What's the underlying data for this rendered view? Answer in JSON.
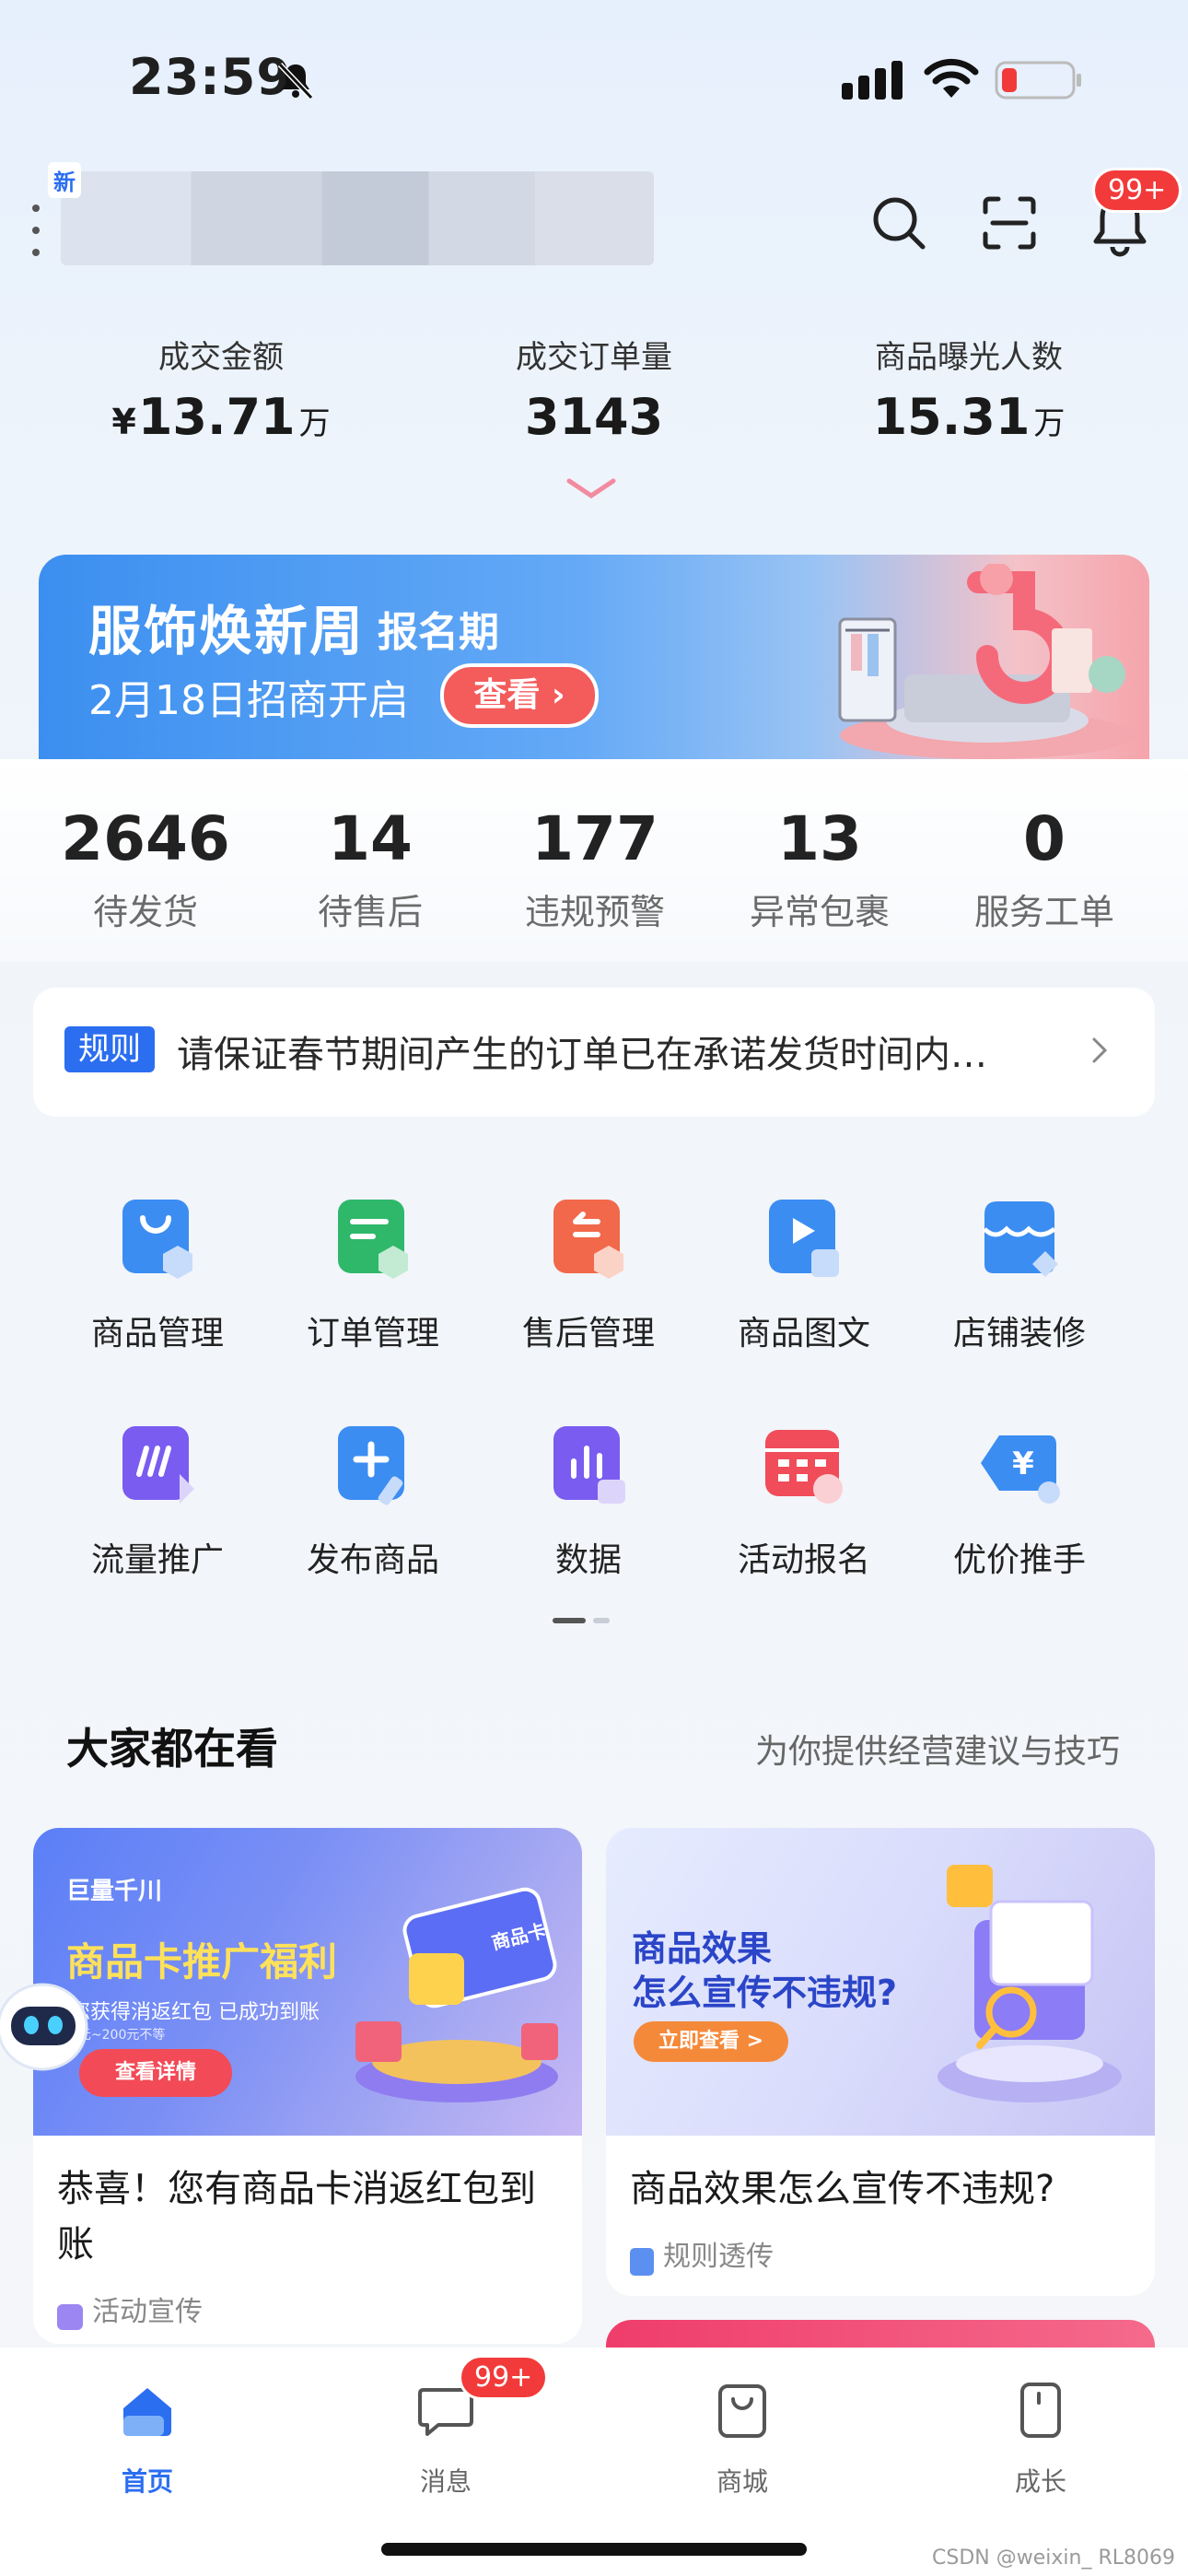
{
  "status_bar": {
    "time": "23:59"
  },
  "header": {
    "store_tag": "新"
  },
  "badges": {
    "notifications": "99+",
    "messages": "99+"
  },
  "metrics": [
    {
      "label": "成交金额",
      "currency": "¥",
      "value": "13.71",
      "unit": "万"
    },
    {
      "label": "成交订单量",
      "currency": "",
      "value": "3143",
      "unit": ""
    },
    {
      "label": "商品曝光人数",
      "currency": "",
      "value": "15.31",
      "unit": "万"
    }
  ],
  "banner": {
    "title": "服饰焕新周",
    "subtitle": "报名期",
    "date_text": "2月18日招商开启",
    "button": "查看 ›"
  },
  "order_stats": [
    {
      "count": "2646",
      "label": "待发货"
    },
    {
      "count": "14",
      "label": "待售后"
    },
    {
      "count": "177",
      "label": "违规预警"
    },
    {
      "count": "13",
      "label": "异常包裹"
    },
    {
      "count": "0",
      "label": "服务工单"
    }
  ],
  "notice": {
    "tag": "规则",
    "text": "请保证春节期间产生的订单已在承诺发货时间内…"
  },
  "tools": [
    {
      "label": "商品管理",
      "icon": "bag-icon",
      "color": "#3b8df2"
    },
    {
      "label": "订单管理",
      "icon": "order-icon",
      "color": "#2fb86a"
    },
    {
      "label": "售后管理",
      "icon": "return-icon",
      "color": "#f2684a"
    },
    {
      "label": "商品图文",
      "icon": "media-icon",
      "color": "#3b8df2"
    },
    {
      "label": "店铺装修",
      "icon": "storefront-icon",
      "color": "#3b8df2"
    },
    {
      "label": "流量推广",
      "icon": "traffic-icon",
      "color": "#7a5cf0"
    },
    {
      "label": "发布商品",
      "icon": "plus-icon",
      "color": "#3b8df2"
    },
    {
      "label": "数据",
      "icon": "chart-icon",
      "color": "#7a5cf0"
    },
    {
      "label": "活动报名",
      "icon": "calendar-icon",
      "color": "#f04c5a"
    },
    {
      "label": "优价推手",
      "icon": "price-tag-icon",
      "color": "#3b8df2"
    }
  ],
  "section": {
    "title": "大家都在看",
    "subtitle": "为你提供经营建议与技巧"
  },
  "cards": [
    {
      "brand": "巨量千川",
      "headline": "商品卡推广福利",
      "sub": "您获得消返红包 已成功到账",
      "range": "0元~200元不等",
      "cta": "查看详情",
      "badge": "商品卡",
      "title": "恭喜！您有商品卡消返红包到账",
      "tag": "活动宣传"
    },
    {
      "headline_line1": "商品效果",
      "headline_line2": "怎么宣传不违规?",
      "cta": "立即查看 >",
      "title": "商品效果怎么宣传不违规?",
      "tag": "规则透传"
    }
  ],
  "tabbar": [
    {
      "label": "首页",
      "active": true
    },
    {
      "label": "消息",
      "active": false
    },
    {
      "label": "商城",
      "active": false
    },
    {
      "label": "成长",
      "active": false
    }
  ],
  "watermark": "CSDN @weixin_ RL8069",
  "colors": {
    "primary": "#2b6ef0",
    "badge": "#f23a3a",
    "banner_btn": "#f45b5b"
  }
}
